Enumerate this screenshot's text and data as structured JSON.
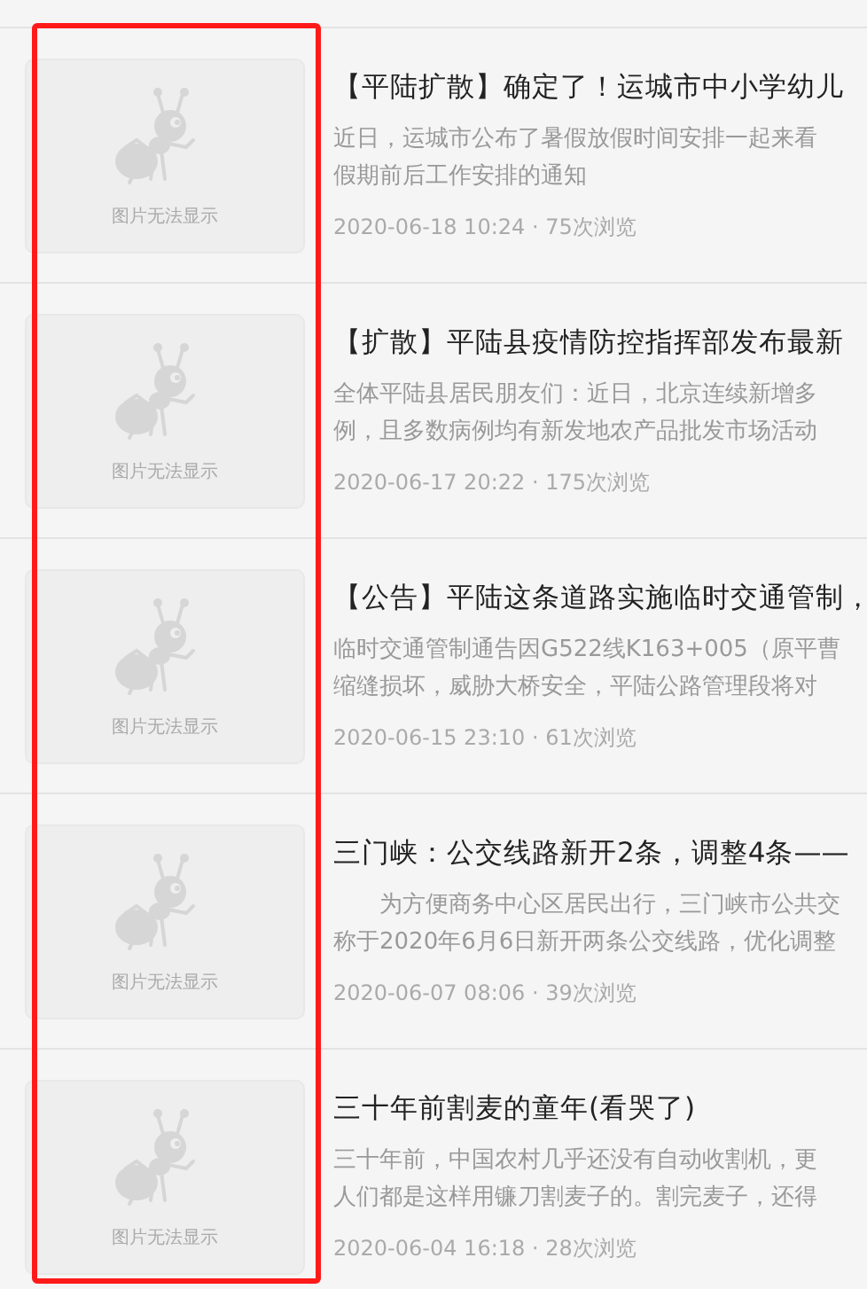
{
  "items": [
    {
      "thumbnail": {
        "caption": "图片无法显示"
      },
      "title": "【平陆扩散】确定了！运城市中小学幼儿",
      "summary": [
        "近日，运城市公布了暑假放假时间安排一起来看",
        "假期前后工作安排的通知"
      ],
      "indent": false,
      "meta": "2020-06-18 10:24 · 75次浏览"
    },
    {
      "thumbnail": {
        "caption": "图片无法显示"
      },
      "title": "【扩散】平陆县疫情防控指挥部发布最新",
      "summary": [
        "全体平陆县居民朋友们：近日，北京连续新增多",
        "例，且多数病例均有新发地农产品批发市场活动"
      ],
      "indent": false,
      "meta": "2020-06-17 20:22 · 175次浏览"
    },
    {
      "thumbnail": {
        "caption": "图片无法显示"
      },
      "title": "【公告】平陆这条道路实施临时交通管制，",
      "summary": [
        "临时交通管制通告因G522线K163+005（原平曹",
        "缩缝损坏，威胁大桥安全，平陆公路管理段将对"
      ],
      "indent": false,
      "meta": "2020-06-15 23:10 · 61次浏览"
    },
    {
      "thumbnail": {
        "caption": "图片无法显示"
      },
      "title": "三门峡：公交线路新开2条，调整4条——",
      "summary": [
        "为方便商务中心区居民出行，三门峡市公共交",
        "称于2020年6月6日新开两条公交线路，优化调整"
      ],
      "indent": true,
      "meta": "2020-06-07 08:06 · 39次浏览"
    },
    {
      "thumbnail": {
        "caption": "图片无法显示"
      },
      "title": "三十年前割麦的童年(看哭了)",
      "summary": [
        "三十年前，中国农村几乎还没有自动收割机，更",
        "人们都是这样用镰刀割麦子的。割完麦子，还得"
      ],
      "indent": false,
      "meta": "2020-06-04 16:18 · 28次浏览"
    }
  ]
}
